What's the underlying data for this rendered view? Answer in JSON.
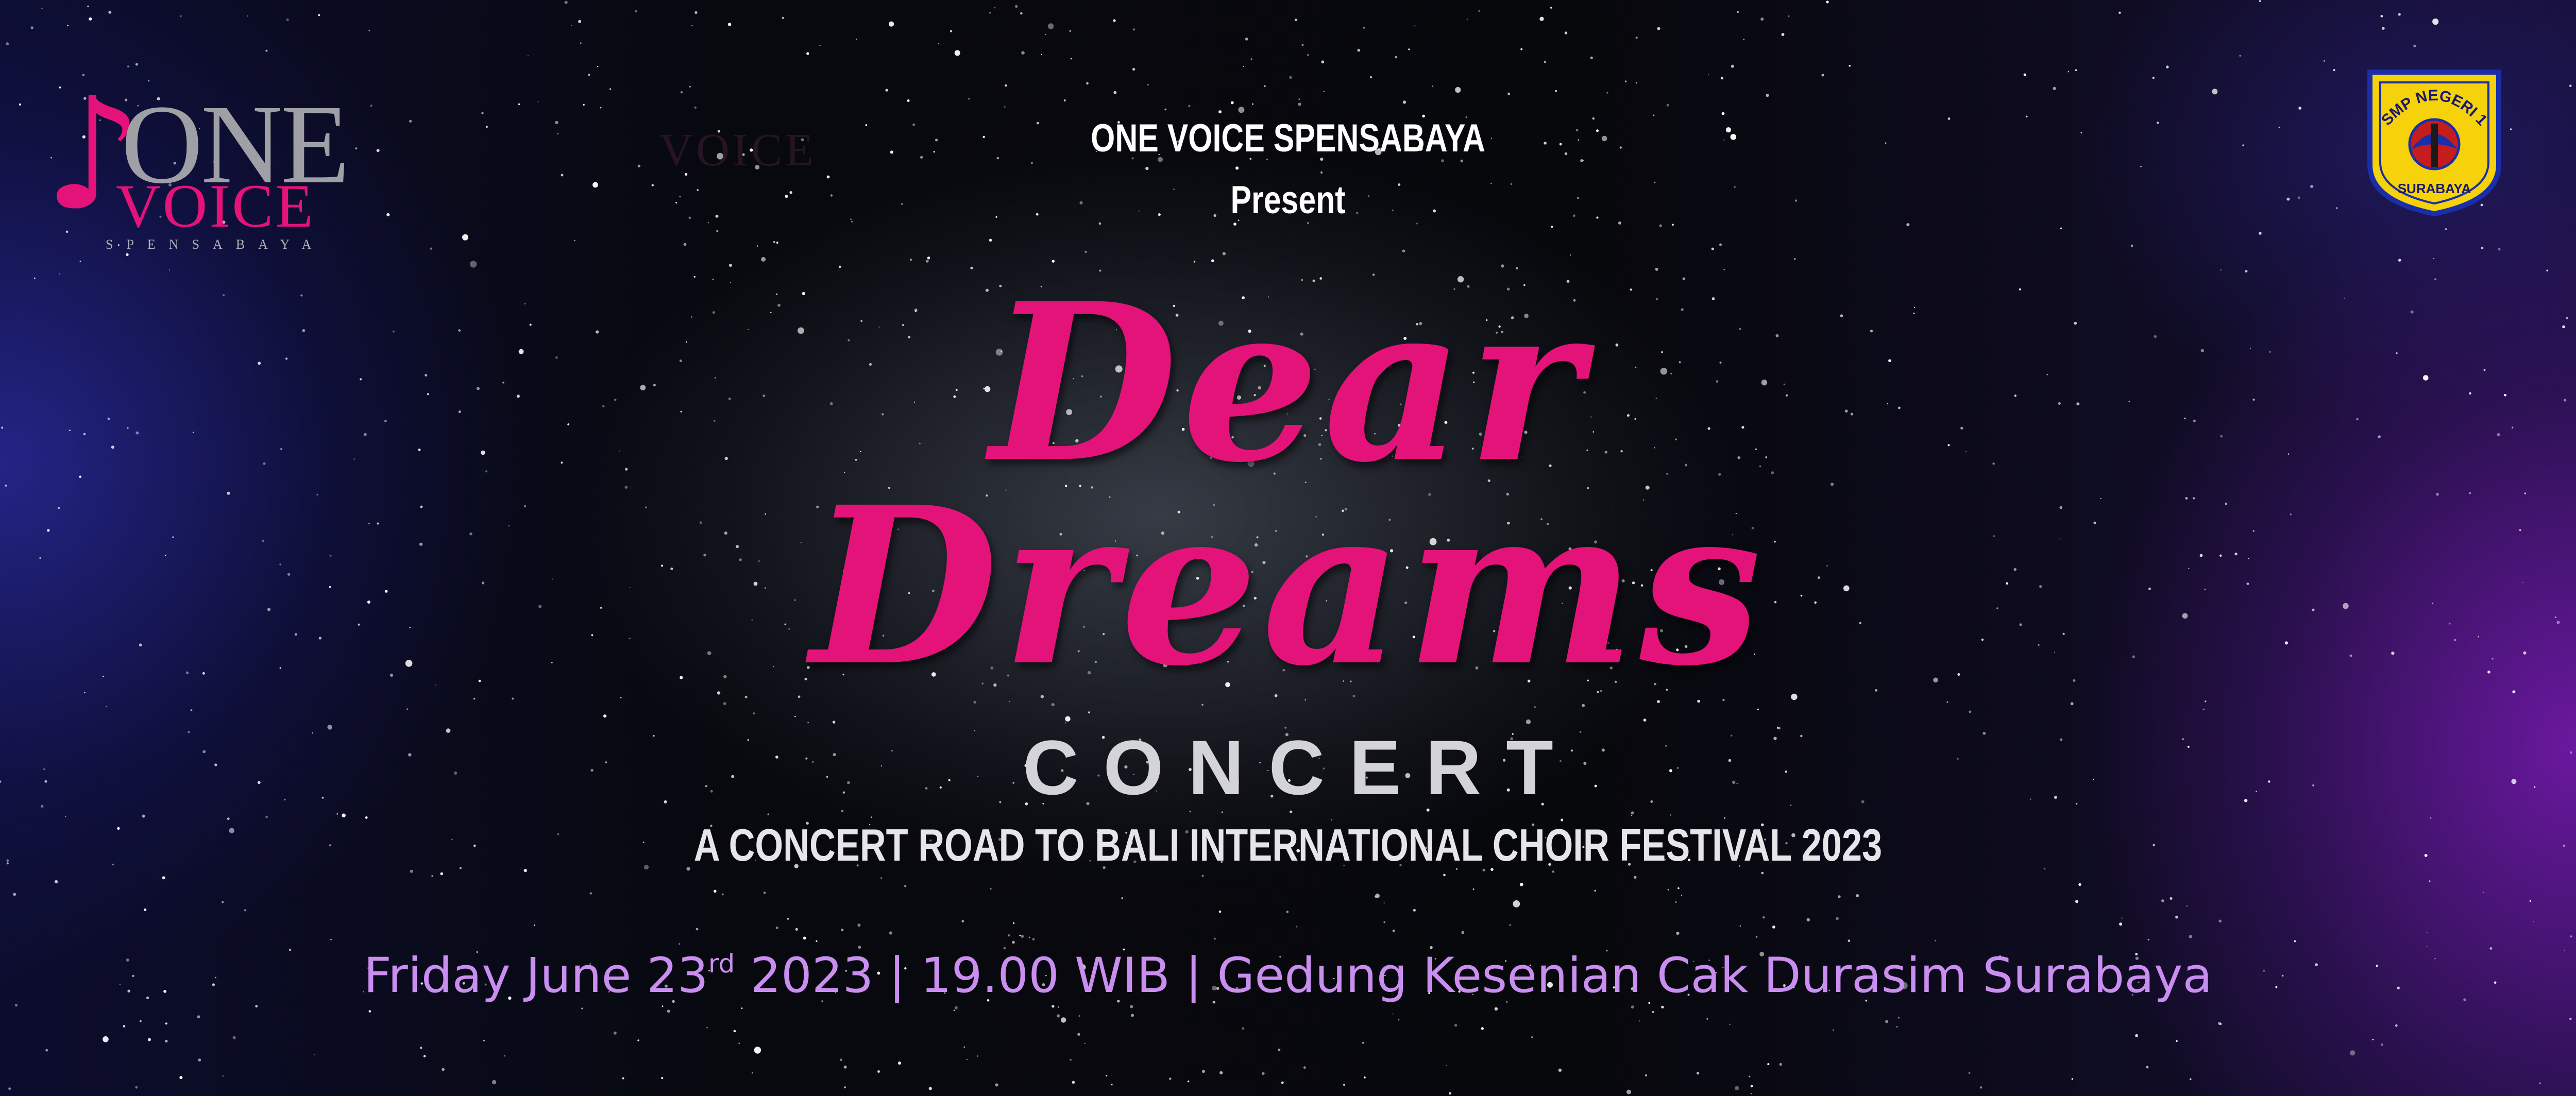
{
  "brand_logo": {
    "letter_one": "ONE",
    "word_voice": "VOICE",
    "subtitle": "SPENSABAYA",
    "ghost_text": "VOICE"
  },
  "school_crest": {
    "top_text": "SMP NEGERI 1",
    "bottom_text": "SURABAYA"
  },
  "header": {
    "presenter": "ONE VOICE SPENSABAYA",
    "present_word": "Present"
  },
  "title": {
    "line1": "Dear",
    "line2": "Dreams",
    "subtitle": "CONCERT"
  },
  "tagline": "A CONCERT ROAD TO BALI INTERNATIONAL CHOIR FESTIVAL 2023",
  "event": {
    "date_prefix": "Friday June 23",
    "date_suffix": "rd",
    "year": " 2023 | ",
    "time": "19.00 WIB",
    "separator": " | ",
    "venue": "Gedung Kesenian Cak Durasim Surabaya"
  },
  "colors": {
    "title_pink": "#e3137a",
    "info_lilac": "#c98ef0",
    "crest_yellow": "#f5d20a",
    "crest_blue": "#1a2ea8"
  }
}
